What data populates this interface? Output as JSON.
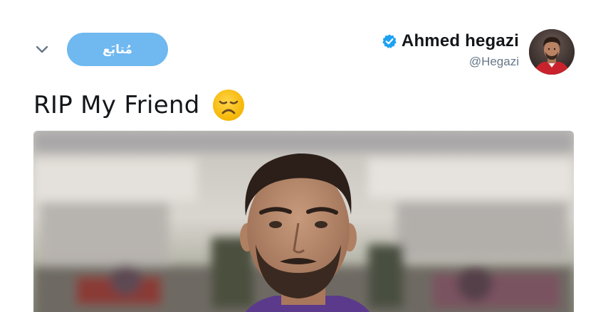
{
  "header": {
    "follow_label": "مُتابَع",
    "display_name": "Ahmed hegazi",
    "handle": "@Hegazi",
    "verified": true,
    "icons": {
      "menu": "chevron-down-icon",
      "verified": "verified-badge-icon",
      "avatar": "profile-avatar"
    }
  },
  "tweet": {
    "text": "RIP My Friend",
    "emoji": "disappointed-face-emoji"
  },
  "media": {
    "type": "photo"
  },
  "colors": {
    "follow_button": "#6fb8f0",
    "verified": "#1da1f2",
    "text": "#14171a",
    "handle": "#657786",
    "emoji": "#f8c62c"
  }
}
